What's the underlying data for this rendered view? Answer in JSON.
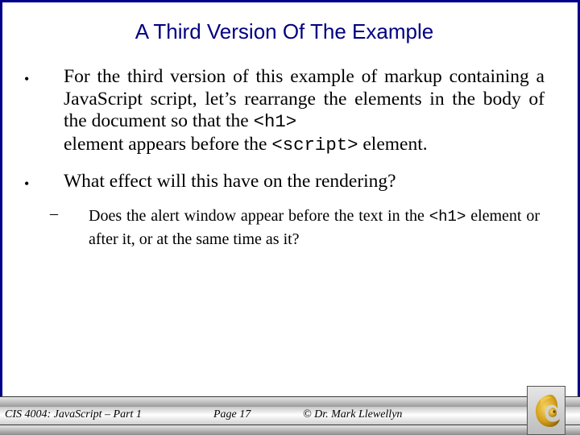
{
  "slide": {
    "title": "A Third Version Of The Example",
    "bullets": [
      {
        "marker": "•",
        "text_parts": [
          "For the third version of this example of markup containing a JavaScript script, let’s rearrange the elements in the body of the document so that the ",
          "<h1>",
          " element appears before the ",
          "<script>",
          "  element."
        ]
      },
      {
        "marker": "•",
        "text": "What effect will this have on the rendering?",
        "sub_bullets": [
          {
            "marker": "–",
            "text_parts": [
              "Does the alert window appear before the text in the ",
              "<h1>",
              " element or after it, or at the same time as it?"
            ]
          }
        ]
      }
    ]
  },
  "footer": {
    "course": "CIS 4004: JavaScript – Part 1",
    "page": "Page 17",
    "copyright": "© Dr. Mark Llewellyn",
    "logo": "ucf-pegasus-logo-icon"
  },
  "colors": {
    "title": "#000080",
    "border": "#00008b",
    "logo_gold": "#d4a017"
  }
}
